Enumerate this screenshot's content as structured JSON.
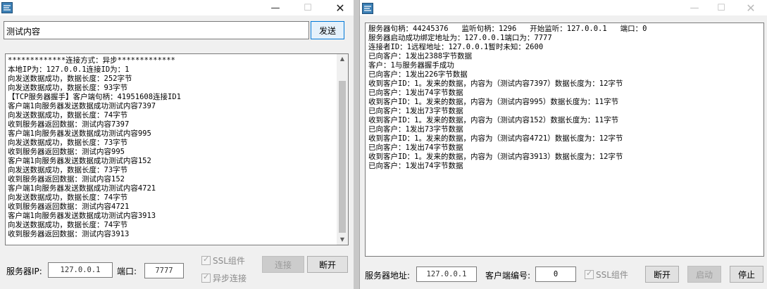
{
  "client": {
    "message_input": "测试内容",
    "send_label": "发送",
    "log_lines": [
      "*************连接方式：异步*************",
      "本地IP为：127.0.0.1连接ID为：1",
      "向发送数据成功，数据长度：252字节",
      "向发送数据成功，数据长度：93字节",
      "【TCP服务器握手】客户端句柄：41951608连接ID1",
      "客户端1向服务器发送数据成功测试内容7397",
      "向发送数据成功，数据长度：74字节",
      "收到服务器返回数据：测试内容7397",
      "客户端1向服务器发送数据成功测试内容995",
      "向发送数据成功，数据长度：73字节",
      "收到服务器返回数据：测试内容995",
      "客户端1向服务器发送数据成功测试内容152",
      "向发送数据成功，数据长度：73字节",
      "收到服务器返回数据：测试内容152",
      "客户端1向服务器发送数据成功测试内容4721",
      "向发送数据成功，数据长度：74字节",
      "收到服务器返回数据：测试内容4721",
      "客户端1向服务器发送数据成功测试内容3913",
      "向发送数据成功，数据长度：74字节",
      "收到服务器返回数据：测试内容3913"
    ],
    "server_ip_label": "服务器IP:",
    "server_ip": "127.0.0.1",
    "port_label": "端口:",
    "port": "7777",
    "ssl_label": "SSL组件",
    "async_label": "异步连接",
    "connect_label": "连接",
    "disconnect_label": "断开"
  },
  "server": {
    "log_lines": [
      "服务器句柄：44245376   监听句柄：1296   开始监听：127.0.0.1   端口：0",
      "服务器启动成功绑定地址为：127.0.0.1端口为：7777",
      "连接者ID：1远程地址：127.0.0.1暂时未知：2600",
      "已向客户：1发出2388字节数据",
      "客户：1与服务器握手成功",
      "已向客户：1发出226字节数据",
      "收到客户ID：1。发来的数据，内容为（测试内容7397）数据长度为：12字节",
      "已向客户：1发出74字节数据",
      "收到客户ID：1。发来的数据，内容为（测试内容995）数据长度为：11字节",
      "已向客户：1发出73字节数据",
      "收到客户ID：1。发来的数据，内容为（测试内容152）数据长度为：11字节",
      "已向客户：1发出73字节数据",
      "收到客户ID：1。发来的数据，内容为（测试内容4721）数据长度为：12字节",
      "已向客户：1发出74字节数据",
      "收到客户ID：1。发来的数据，内容为（测试内容3913）数据长度为：12字节",
      "已向客户：1发出74字节数据"
    ],
    "address_label": "服务器地址:",
    "address": "127.0.0.1",
    "client_no_label": "客户端编号:",
    "client_no": "0",
    "ssl_label": "SSL组件",
    "disconnect_label": "断开",
    "start_label": "启动",
    "stop_label": "停止"
  },
  "colors": {
    "accent": "#0078d7",
    "disabled": "#9a9a9a",
    "scroll_thumb": "#c2c2c2"
  },
  "icons": [
    "app-icon",
    "minimize-icon",
    "maximize-icon",
    "close-icon",
    "scroll-up-icon",
    "scroll-down-icon"
  ]
}
